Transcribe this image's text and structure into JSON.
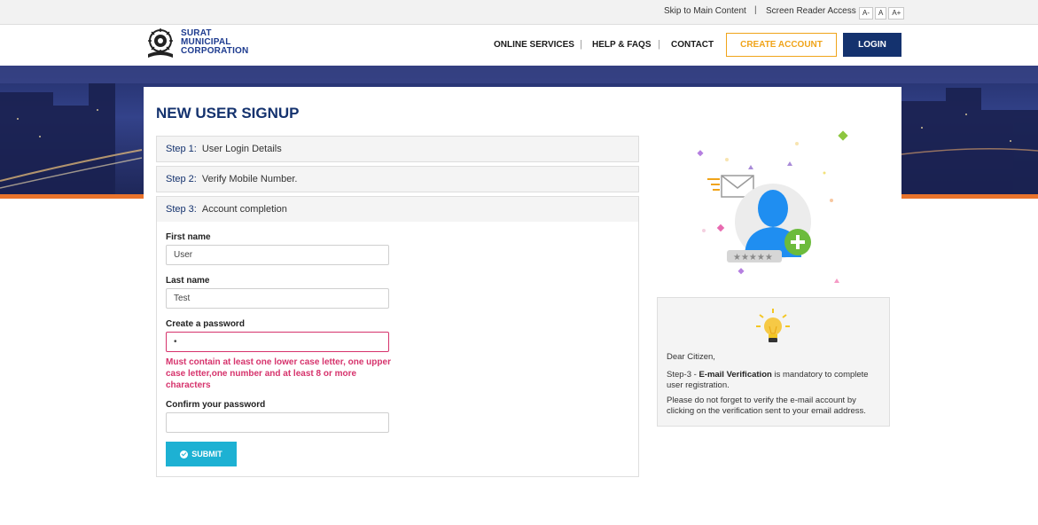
{
  "topbar": {
    "skip_link": "Skip to Main Content",
    "separator": "|",
    "screen_reader": "Screen Reader Access",
    "font_smaller": "A-",
    "font_normal": "A",
    "font_larger": "A+"
  },
  "header": {
    "logo_line1": "SURAT",
    "logo_line2": "MUNICIPAL",
    "logo_line3": "CORPORATION",
    "nav": {
      "online_services": "ONLINE SERVICES",
      "help_faqs": "HELP & FAQS",
      "contact": "CONTACT",
      "separator": "|"
    },
    "create_account": "CREATE ACCOUNT",
    "login": "LOGIN"
  },
  "signup": {
    "title": "NEW USER SIGNUP",
    "steps": [
      {
        "number": "Step 1:",
        "label": "User Login Details"
      },
      {
        "number": "Step 2:",
        "label": "Verify Mobile Number."
      },
      {
        "number": "Step 3:",
        "label": "Account completion"
      }
    ],
    "first_name_label": "First name",
    "first_name_value": "User",
    "last_name_label": "Last name",
    "last_name_value": "Test",
    "password_label": "Create a password",
    "password_value": "•",
    "password_error": "Must contain at least one lower case letter, one upper case letter,one number and at least 8 or more characters",
    "confirm_label": "Confirm your password",
    "confirm_value": "",
    "submit": "SUBMIT"
  },
  "info": {
    "greeting": "Dear Citizen,",
    "step_prefix": "Step-3 - ",
    "step_bold": "E-mail Verification",
    "step_rest": " is mandatory to complete user registration.",
    "reminder": "Please do not forget to verify the e-mail account by clicking on the verification sent to your email address."
  },
  "colors": {
    "brand_navy": "#14326e",
    "accent_orange": "#f0a41a",
    "submit_cyan": "#1db1d3",
    "error_pink": "#d6336c",
    "banner_orange": "#e9732b"
  },
  "icons": [
    "smc-logo-icon",
    "envelope-icon",
    "user-avatar-icon",
    "plus-icon",
    "lightbulb-icon",
    "check-circle-icon"
  ]
}
